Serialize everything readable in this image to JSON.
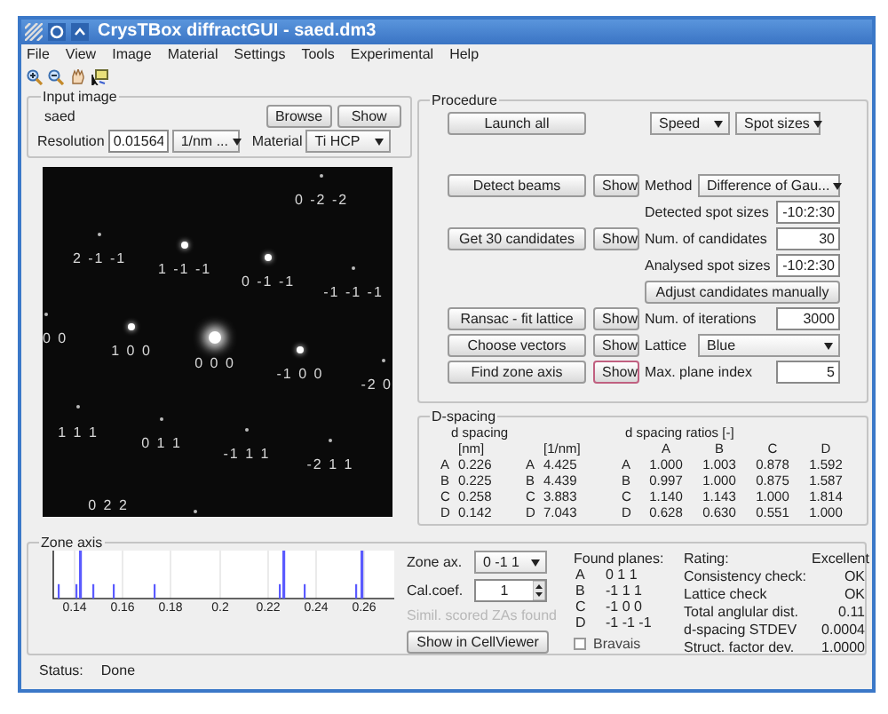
{
  "window": {
    "title": "CrysTBox diffractGUI - saed.dm3"
  },
  "menu": [
    "File",
    "View",
    "Image",
    "Material",
    "Settings",
    "Tools",
    "Experimental",
    "Help"
  ],
  "input_image": {
    "title": "Input image",
    "file": "saed",
    "browse": "Browse",
    "show": "Show",
    "resolution_label": "Resolution",
    "resolution": "0.01564",
    "unit": "1/nm ...",
    "material_label": "Material",
    "material": "Ti HCP"
  },
  "diffraction_spots": [
    "0 -2 -2",
    "2 -1 -1",
    "1 -1 -1",
    "0 -1 -1",
    "-1 -1 -1",
    "0 0",
    "1 0 0",
    "0 0 0",
    "-1 0 0",
    "-2 0",
    "1 1 1",
    "0 1 1",
    "-1 1 1",
    "-2 1 1",
    "0 2 2"
  ],
  "procedure": {
    "title": "Procedure",
    "launch": "Launch all",
    "speed": "Speed",
    "spot_sizes": "Spot sizes",
    "rows": [
      {
        "step": {
          "label": "Detect beams",
          "show": "Show",
          "focused": false
        },
        "control": {
          "kind": "dropdown",
          "label": "Method",
          "value": "Difference of Gau..."
        }
      },
      {
        "control": {
          "kind": "input",
          "label": "Detected spot sizes",
          "value": "-10:2:30"
        }
      },
      {
        "step": {
          "label": "Get 30 candidates",
          "show": "Show",
          "focused": false
        },
        "control": {
          "kind": "input",
          "label": "Num. of candidates",
          "value": "30"
        }
      },
      {
        "control": {
          "kind": "input",
          "label": "Analysed spot sizes",
          "value": "-10:2:30"
        }
      },
      {
        "control": {
          "kind": "button",
          "label": "Adjust candidates manually"
        }
      },
      {
        "step": {
          "label": "Ransac - fit lattice",
          "show": "Show",
          "focused": false
        },
        "control": {
          "kind": "input",
          "label": "Num. of iterations",
          "value": "3000"
        }
      },
      {
        "step": {
          "label": "Choose vectors",
          "show": "Show",
          "focused": false
        },
        "control": {
          "kind": "dropdown",
          "label": "Lattice",
          "value": "Blue"
        }
      },
      {
        "step": {
          "label": "Find zone axis",
          "show": "Show",
          "focused": true
        },
        "control": {
          "kind": "input",
          "label": "Max. plane index",
          "value": "5"
        }
      }
    ]
  },
  "d_spacing": {
    "title": "D-spacing",
    "nm_title": "d spacing",
    "nm_unit": "[nm]",
    "inv_unit": "[1/nm]",
    "ratio_title": "d spacing ratios [-]",
    "columns": [
      "A",
      "B",
      "C",
      "D"
    ],
    "rows": [
      {
        "nm_name": "A",
        "nm": "0.226",
        "inv_name": "A",
        "inv": "4.425",
        "ratio_name": "A",
        "ratios": [
          "1.000",
          "1.003",
          "0.878",
          "1.592"
        ]
      },
      {
        "nm_name": "B",
        "nm": "0.225",
        "inv_name": "B",
        "inv": "4.439",
        "ratio_name": "B",
        "ratios": [
          "0.997",
          "1.000",
          "0.875",
          "1.587"
        ]
      },
      {
        "nm_name": "C",
        "nm": "0.258",
        "inv_name": "C",
        "inv": "3.883",
        "ratio_name": "C",
        "ratios": [
          "1.140",
          "1.143",
          "1.000",
          "1.814"
        ]
      },
      {
        "nm_name": "D",
        "nm": "0.142",
        "inv_name": "D",
        "inv": "7.043",
        "ratio_name": "D",
        "ratios": [
          "0.628",
          "0.630",
          "0.551",
          "1.000"
        ]
      }
    ]
  },
  "zone_axis": {
    "title": "Zone axis",
    "plot_ticks": [
      "0.14",
      "0.16",
      "0.18",
      "0.2",
      "0.22",
      "0.24",
      "0.26"
    ],
    "zone_ax_label": "Zone ax.",
    "zone_ax": "0 -1 1",
    "cal_label": "Cal.coef.",
    "cal": "1",
    "similar": "Simil. scored ZAs found",
    "similar_disabled": true,
    "cellviewer": "Show in CellViewer",
    "found_title": "Found planes:",
    "planes": [
      {
        "name": "A",
        "value": "0 1 1"
      },
      {
        "name": "B",
        "value": "-1 1 1"
      },
      {
        "name": "C",
        "value": "-1 0 0"
      },
      {
        "name": "D",
        "value": "-1 -1 -1"
      }
    ],
    "bravais": {
      "label": "Bravais",
      "checked": false
    },
    "metrics": [
      {
        "label": "Rating:",
        "value": "Excellent"
      },
      {
        "label": "Consistency check:",
        "value": "OK"
      },
      {
        "label": "Lattice check",
        "value": "OK"
      },
      {
        "label": "Total anglular dist.",
        "value": "0.11"
      },
      {
        "label": "d-spacing STDEV",
        "value": "0.0004"
      },
      {
        "label": "Struct. factor dev.",
        "value": "1.0000"
      }
    ]
  },
  "status": {
    "label": "Status:",
    "value": "Done"
  }
}
